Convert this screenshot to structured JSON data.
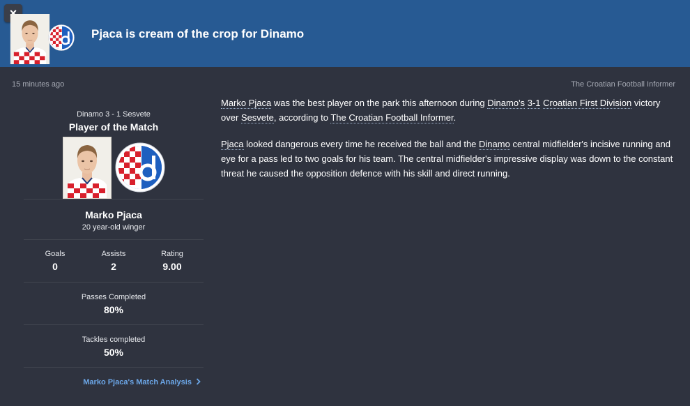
{
  "header": {
    "close_label": "×",
    "headline": "Pjaca is cream of the crop for Dinamo",
    "accent_color": "#275a93"
  },
  "meta": {
    "timestamp": "15 minutes ago",
    "source": "The Croatian Football Informer"
  },
  "potm": {
    "score_line": "Dinamo 3 - 1 Sesvete",
    "title": "Player of the Match",
    "player_name": "Marko Pjaca",
    "player_desc": "20 year-old winger",
    "stats": [
      {
        "label": "Goals",
        "value": "0"
      },
      {
        "label": "Assists",
        "value": "2"
      },
      {
        "label": "Rating",
        "value": "9.00"
      }
    ],
    "passes_label": "Passes Completed",
    "passes_value": "80%",
    "tackles_label": "Tackles completed",
    "tackles_value": "50%",
    "analysis_link": "Marko Pjaca's Match Analysis",
    "analysis_icon": "chevron-right-icon"
  },
  "article": {
    "p1": {
      "name": "Marko Pjaca",
      "t1": " was the best player on the park this afternoon during ",
      "club": "Dinamo's",
      "t2": " ",
      "score": "3-1",
      "t3": " ",
      "competition": "Croatian First Division",
      "t4": " victory over ",
      "opponent": "Sesvete",
      "t5": ", according to ",
      "source": "The Croatian Football Informer",
      "t6": "."
    },
    "p2": {
      "name": "Pjaca",
      "t1": " looked dangerous every time he received the ball and the ",
      "club": "Dinamo",
      "t2": " central midfielder's incisive running and eye for a pass led to two goals for his team. The central midfielder's impressive display was down to the constant threat he caused the opposition defence with his skill and direct running."
    }
  }
}
